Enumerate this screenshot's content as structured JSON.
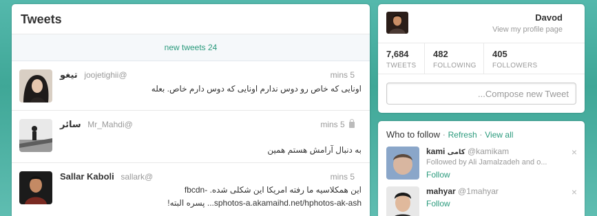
{
  "timeline": {
    "title": "Tweets",
    "new_tweets": "new tweets 24",
    "tweets": [
      {
        "fullname": "تیغو",
        "username": "joojetighii@",
        "time": "mins 5",
        "text": "اونایی که خاص رو دوس ندارم اونایی که دوس دارم خاص. بعله"
      },
      {
        "fullname": "سائر",
        "username": "Mr_Mahdi@",
        "time": "mins 5",
        "protected": true,
        "text": "به دنبال آرامش هستم همین"
      },
      {
        "fullname": "Sallar Kaboli",
        "username": "sallark@",
        "time": "mins 5",
        "text_line1": "این همکلاسیه ما رفته امریکا این شکلی شده. -fbcdn",
        "text_line2": "sphotos-a.akamaihd.net/hphotos-ak-ash... پسره البته!"
      }
    ]
  },
  "profile": {
    "name": "Davod",
    "view_profile": "View my profile page",
    "stats": [
      {
        "value": "7,684",
        "label": "TWEETS"
      },
      {
        "value": "482",
        "label": "FOLLOWING"
      },
      {
        "value": "405",
        "label": "FOLLOWERS"
      }
    ],
    "compose_placeholder": "Compose new Tweet..."
  },
  "who_to_follow": {
    "title": "Who to follow",
    "separator": "·",
    "refresh": "Refresh",
    "view_all": "View all",
    "suggestions": [
      {
        "name": "kami",
        "name_extra": "کامی",
        "handle": "@kamikam",
        "followed_by": "Followed by Ali Jamalzadeh and o...",
        "follow": "Follow",
        "close": "×"
      },
      {
        "name": "mahyar",
        "handle": "@1mahyar",
        "follow": "Follow",
        "close": "×"
      }
    ]
  },
  "colors": {
    "background": "#4fb3a6",
    "link": "#2a9a7c"
  }
}
